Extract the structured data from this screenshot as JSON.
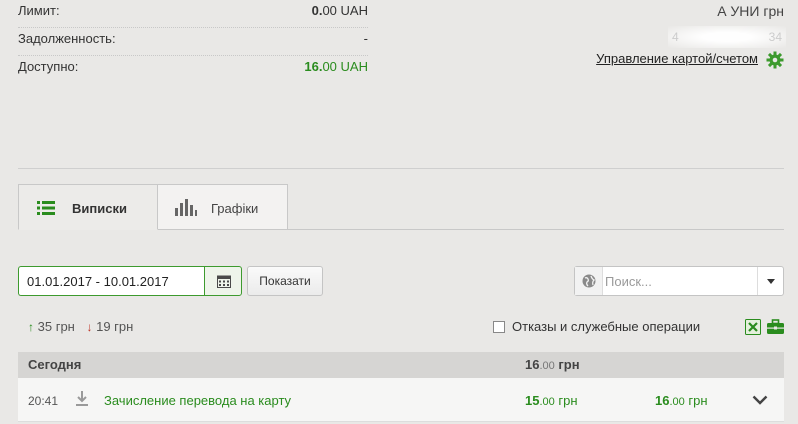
{
  "summary": {
    "limit_label": "Лимит:",
    "limit_int": "0.",
    "limit_frac": "00",
    "limit_cur": "UAH",
    "debt_label": "Задолженность:",
    "debt_value": "-",
    "available_label": "Доступно:",
    "available_int": "16.",
    "available_frac": "00",
    "available_cur": "UAH"
  },
  "card": {
    "name": "А УНИ грн",
    "manage_link": "Управление картой/счетом"
  },
  "tabs": [
    {
      "label": "Виписки",
      "icon": "list-icon",
      "active": true
    },
    {
      "label": "Графіки",
      "icon": "bar-chart-icon",
      "active": false
    }
  ],
  "filter": {
    "date_range": "01.01.2017 - 10.01.2017",
    "show_label": "Показати",
    "search_placeholder": "Поиск..."
  },
  "totals": {
    "income": "35 грн",
    "expense": "19 грн"
  },
  "refusals_label": "Отказы и служебные операции",
  "group": {
    "title": "Сегодня",
    "sum_int": "16",
    "sum_frac": ".00",
    "sum_cur": "грн"
  },
  "transaction": {
    "time": "20:41",
    "description": "Зачисление перевода на карту",
    "amount_int": "15",
    "amount_frac": ".00",
    "amount_cur": "грн",
    "balance_int": "16",
    "balance_frac": ".00",
    "balance_cur": "грн"
  },
  "colors": {
    "accent_green": "#2a8c1e",
    "expense_red": "#c0392b"
  }
}
